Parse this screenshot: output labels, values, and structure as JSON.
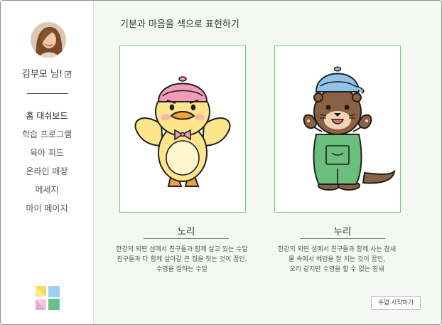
{
  "sidebar": {
    "username": "김부모 님!",
    "nav": [
      {
        "label": "홈 대쉬보드"
      },
      {
        "label": "학습 프로그램"
      },
      {
        "label": "육아 피드"
      },
      {
        "label": "온라인 매장"
      },
      {
        "label": "메세지"
      },
      {
        "label": "마이 페이지"
      }
    ]
  },
  "main": {
    "title": "기분과 마음을 색으로 표현하기",
    "characters": [
      {
        "name": "노리",
        "description": "한강의 외딴 섬에서 친구들과 함께 살고 있는 수달\n친구들과 다 함께 살아갈 큰 집을 짓는 것이 꿈인,\n수영을 잘하는 수달"
      },
      {
        "name": "누리",
        "description": "한강의 외딴 섬에서 친구들과 함께 사는 참새\n물 속에서 헤엄을 잘 치는 것이 꿈인,\n오리 같지만 수영을 할 수 없는 참새"
      }
    ],
    "start_button": "수업 시작하기"
  },
  "colors": {
    "accent_green": "#72c58e",
    "background_green": "#f3f8f3"
  }
}
